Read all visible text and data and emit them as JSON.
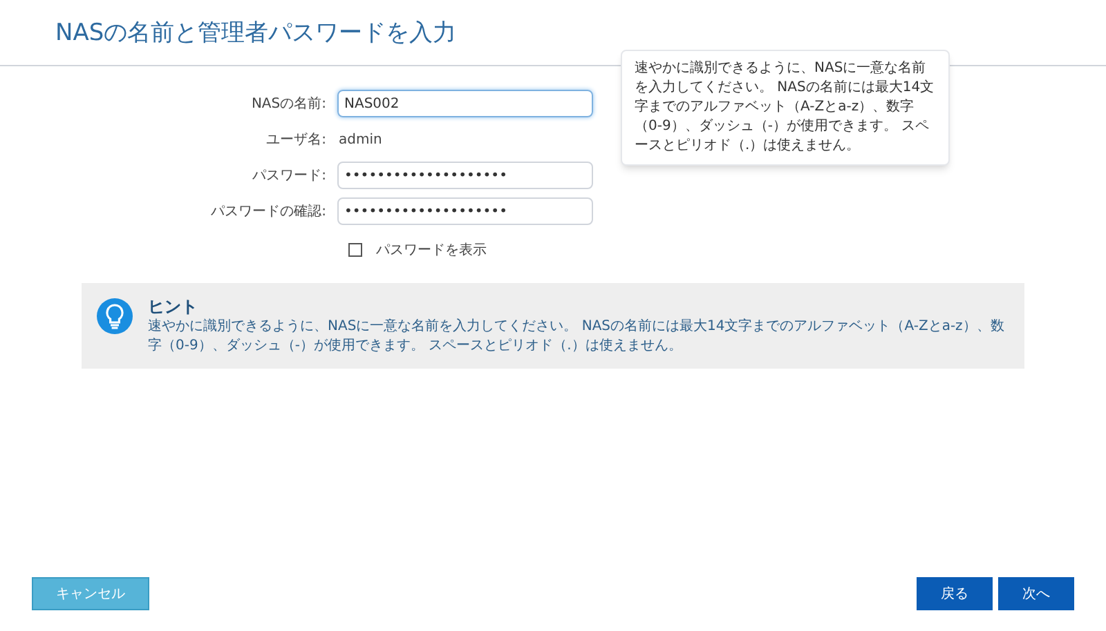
{
  "title": "NASの名前と管理者パスワードを入力",
  "fields": [
    {
      "kind": "input",
      "label": "NASの名前:",
      "value": "NAS002",
      "focused": true
    },
    {
      "kind": "text",
      "label": "ユーザ名:",
      "value": "admin"
    },
    {
      "kind": "input",
      "label": "パスワード:",
      "value": "••••••••••••••••••••",
      "focused": false
    },
    {
      "kind": "input",
      "label": "パスワードの確認:",
      "value": "••••••••••••••••••••",
      "focused": false
    }
  ],
  "show_password": {
    "label": "パスワードを表示",
    "checked": false
  },
  "tooltip": "速やかに識別できるように、NASに一意な名前を入力してください。 NASの名前には最大14文字までのアルファベット（A-Zとa-z）、数字（0-9）、ダッシュ（-）が使用できます。 スペースとピリオド（.）は使えません。",
  "hint": {
    "title": "ヒント",
    "text": "速やかに識別できるように、NASに一意な名前を入力してください。 NASの名前には最大14文字までのアルファベット（A-Zとa-z）、数字（0-9）、ダッシュ（-）が使用できます。 スペースとピリオド（.）は使えません。"
  },
  "buttons": {
    "cancel": "キャンセル",
    "back": "戻る",
    "next": "次へ"
  }
}
